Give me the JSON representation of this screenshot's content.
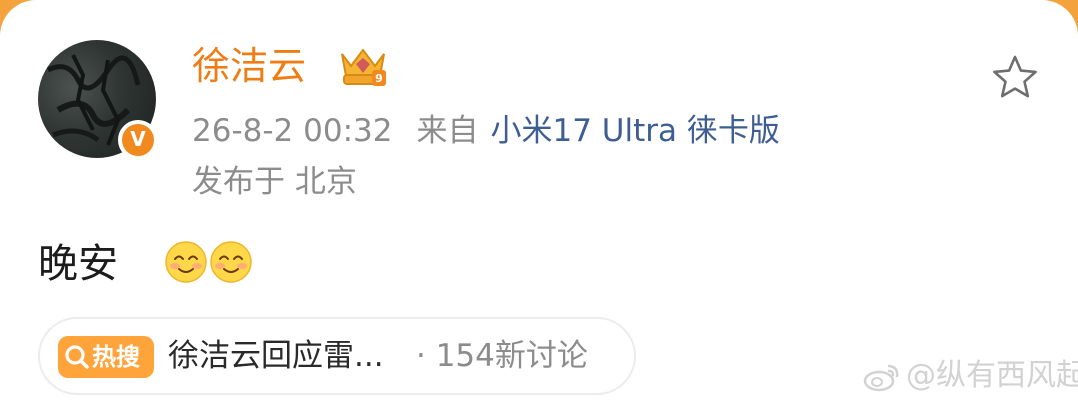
{
  "post": {
    "username": "徐洁云",
    "verified_badge": "V",
    "timestamp": "26-8-2 00:32",
    "source_label": "来自",
    "device": "小米17 Ultra 徕卡版",
    "location": "发布于 北京",
    "text": "晚安",
    "emojis": [
      "smiling-face-emoji",
      "smiling-face-emoji"
    ]
  },
  "hot_topic": {
    "badge_label": "热搜",
    "badge_icon": "search-icon",
    "title": "徐洁云回应雷...",
    "count": "· 154新讨论"
  },
  "watermark": {
    "text": "@纵有西风起",
    "logo_icon": "weibo-icon"
  },
  "icons": {
    "favorite": "star-outline-icon",
    "rank": "crown-badge-icon"
  },
  "colors": {
    "username": "#ef7d16",
    "device_link": "#3e5e93",
    "hot_badge": "#ffa33b",
    "background_accent": "#f4a23c"
  }
}
